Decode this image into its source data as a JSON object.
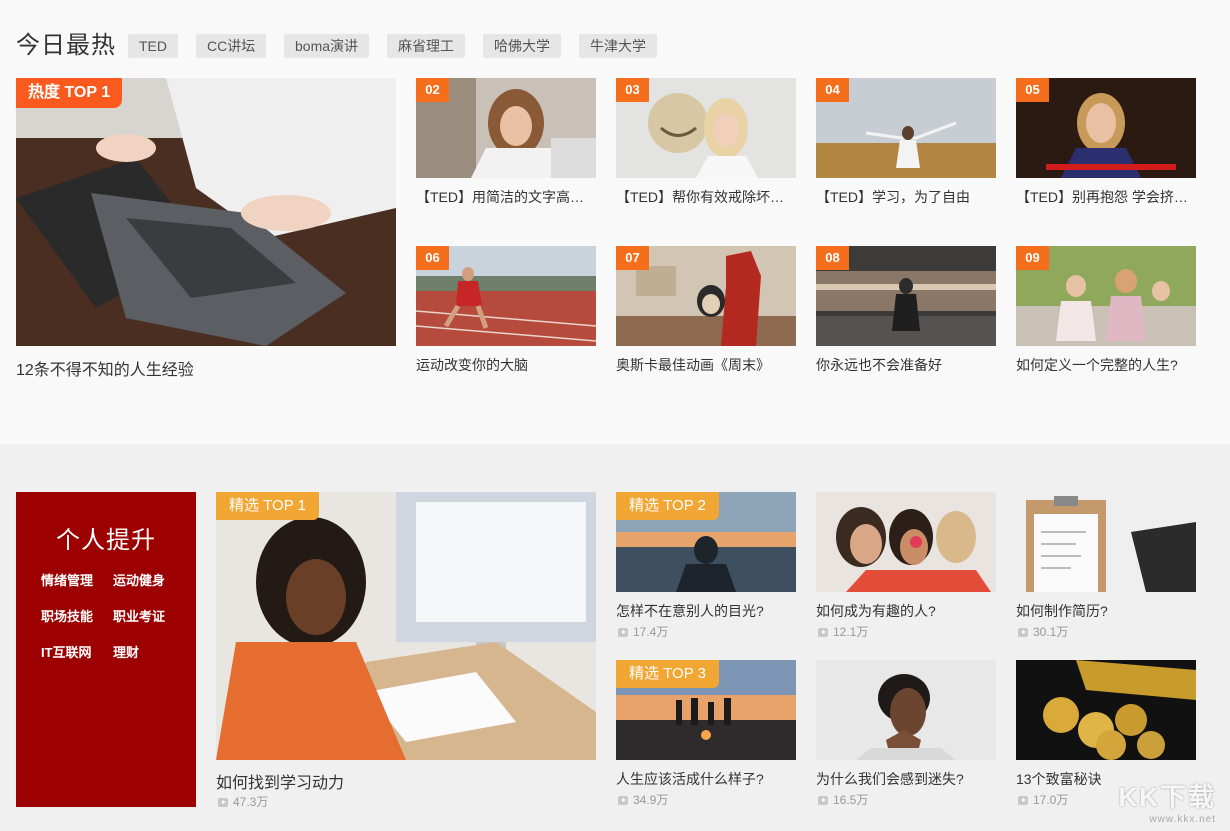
{
  "hot": {
    "title": "今日最热",
    "tags": [
      "TED",
      "CC讲坛",
      "boma演讲",
      "麻省理工",
      "哈佛大学",
      "牛津大学"
    ],
    "top": {
      "rank": "热度 TOP 1",
      "caption": "12条不得不知的人生经验"
    },
    "items": [
      {
        "rank": "02",
        "caption": "【TED】用简洁的文字高…"
      },
      {
        "rank": "03",
        "caption": "【TED】帮你有效戒除坏…"
      },
      {
        "rank": "04",
        "caption": "【TED】学习，为了自由"
      },
      {
        "rank": "05",
        "caption": "【TED】别再抱怨 学会挤…"
      },
      {
        "rank": "06",
        "caption": "运动改变你的大脑"
      },
      {
        "rank": "07",
        "caption": "奥斯卡最佳动画《周末》"
      },
      {
        "rank": "08",
        "caption": "你永远也不会准备好"
      },
      {
        "rank": "09",
        "caption": "如何定义一个完整的人生?"
      }
    ]
  },
  "pick": {
    "category_title": "个人提升",
    "category_links": [
      "情绪管理",
      "运动健身",
      "职场技能",
      "职业考证",
      "IT互联网",
      "理财"
    ],
    "top": {
      "badge": "精选 TOP 1",
      "caption": "如何找到学习动力",
      "views": "47.3万"
    },
    "items": [
      {
        "badge": "精选 TOP 2",
        "caption": "怎样不在意别人的目光?",
        "views": "17.4万"
      },
      {
        "badge": "",
        "caption": "如何成为有趣的人?",
        "views": "12.1万"
      },
      {
        "badge": "",
        "caption": "如何制作简历?",
        "views": "30.1万"
      },
      {
        "badge": "精选 TOP 3",
        "caption": "人生应该活成什么样子?",
        "views": "34.9万"
      },
      {
        "badge": "",
        "caption": "为什么我们会感到迷失?",
        "views": "16.5万"
      },
      {
        "badge": "",
        "caption": "13个致富秘诀",
        "views": "17.0万"
      }
    ]
  },
  "watermark": {
    "brand": "KK下载",
    "url": "www.kkx.net"
  },
  "colors": {
    "hot_rank": "#f56e1b",
    "pick_badge": "#f2a633",
    "category_bg": "#9c0000"
  }
}
